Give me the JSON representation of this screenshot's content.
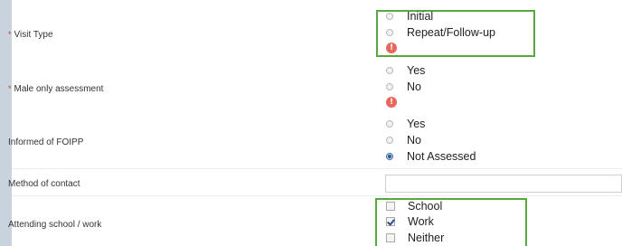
{
  "fields": {
    "visit_type": {
      "label": "Visit Type",
      "required": true,
      "options": [
        "Initial",
        "Repeat/Follow-up"
      ],
      "selected": null,
      "error_icon": "!"
    },
    "male_only": {
      "label": "Male only assessment",
      "required": true,
      "options": [
        "Yes",
        "No"
      ],
      "selected": null,
      "error_icon": "!"
    },
    "foipp": {
      "label": "Informed of FOIPP",
      "required": false,
      "options": [
        "Yes",
        "No",
        "Not Assessed"
      ],
      "selected": "Not Assessed"
    },
    "method_of_contact": {
      "label": "Method of contact",
      "value": ""
    },
    "attending": {
      "label": "Attending school / work",
      "options": [
        "School",
        "Work",
        "Neither"
      ],
      "checked": [
        "Work"
      ]
    }
  },
  "colors": {
    "required_marker": "#d23a2e",
    "highlight_box": "#58a842",
    "error_icon": "#e8675d"
  }
}
